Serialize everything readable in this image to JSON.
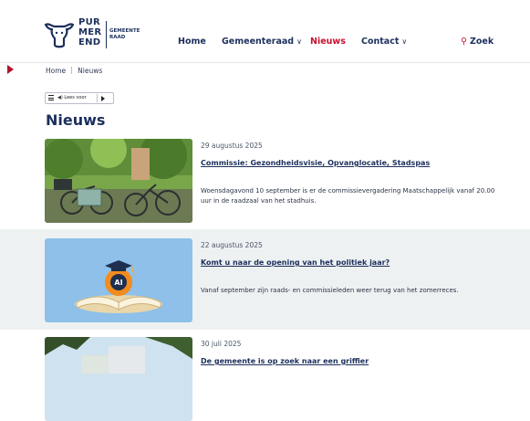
{
  "logo": {
    "words": [
      "PUR",
      "MER",
      "END"
    ],
    "sub": [
      "GEMEENTE",
      "RAAD"
    ]
  },
  "nav": [
    {
      "label": "Home",
      "chevron": false,
      "active": false
    },
    {
      "label": "Gemeenteraad",
      "chevron": true,
      "active": false
    },
    {
      "label": "Nieuws",
      "chevron": false,
      "active": true
    },
    {
      "label": "Contact",
      "chevron": true,
      "active": false
    }
  ],
  "search": {
    "label": "Zoek"
  },
  "breadcrumb": [
    "Home",
    "Nieuws"
  ],
  "reader": {
    "label": "◀) Lees voor"
  },
  "page_title": "Nieuws",
  "news": [
    {
      "date": "29 augustus 2025",
      "title": "Commissie: Gezondheidsvisie, Opvanglocatie, Stadspas",
      "description": "Woensdagavond 10 september is er de commissievergadering Maatschappelijk vanaf 20.00 uur in de raadzaal van het stadhuis."
    },
    {
      "date": "22 augustus 2025",
      "title": "Komt u naar de opening van het politiek jaar?",
      "description": "Vanaf september zijn raads- en commissieleden weer terug van het zomerreces.",
      "image_text": "AI"
    },
    {
      "date": "30 juli 2025",
      "title": "De gemeente is op zoek naar een griffier",
      "description": ""
    }
  ],
  "colors": {
    "brand": "#1c2f5c",
    "accent": "#c8102e",
    "band": "#eef1f2"
  }
}
